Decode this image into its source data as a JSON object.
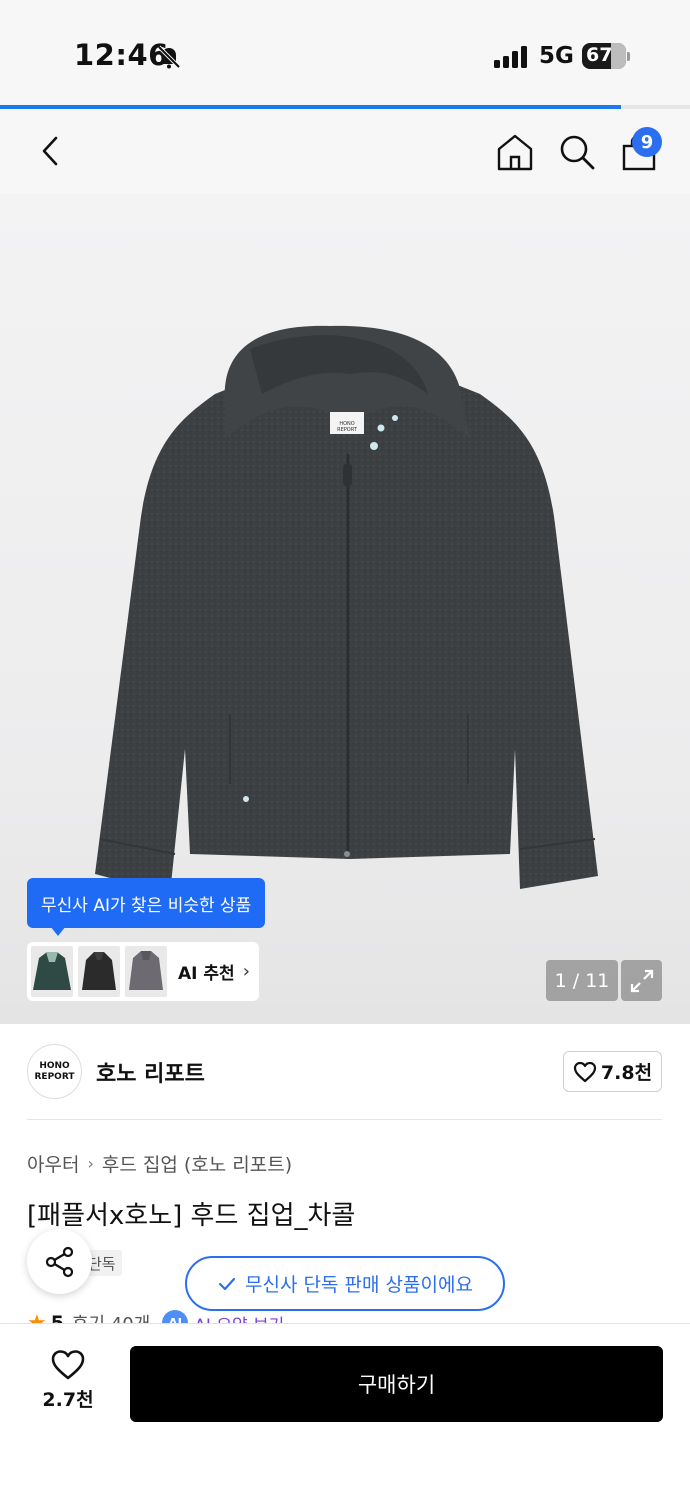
{
  "status_bar": {
    "time": "12:46",
    "network": "5G",
    "battery": "67",
    "battery_level": 67
  },
  "load_progress": 0.9,
  "header": {
    "cart_count": "9",
    "icons": [
      "chevron-left-icon",
      "home-icon",
      "search-icon",
      "shopping-bag-icon"
    ]
  },
  "hero": {
    "ai_tooltip": "무신사 AI가 찾은 비슷한 상품",
    "ai_card_label": "AI 추천",
    "ai_card_chevron": "›",
    "page_indicator": "1 / 11",
    "garment_label": "HONO REPORT"
  },
  "brand": {
    "logo_line1": "HONO",
    "logo_line2": "REPORT",
    "name": "호노 리포트",
    "likes": "7.8천"
  },
  "product": {
    "breadcrumb": [
      "아우터",
      "후드 집업 (호노 리포트)"
    ],
    "breadcrumb_sep": "›",
    "title": "[패플서x호노] 후드 집업_차콜",
    "tag": "단독",
    "exclusive_notice": "무신사 단독 판매 상품이에요",
    "rating": "5",
    "reviews": "후기 40개",
    "ai_badge": "AI",
    "ai_summary": "AI 요약 보기"
  },
  "bottom_bar": {
    "like_count": "2.7천",
    "buy_label": "구매하기"
  },
  "colors": {
    "accent": "#2b6ff0",
    "buy_button": "#000000",
    "rating_star": "#ff8c00"
  }
}
